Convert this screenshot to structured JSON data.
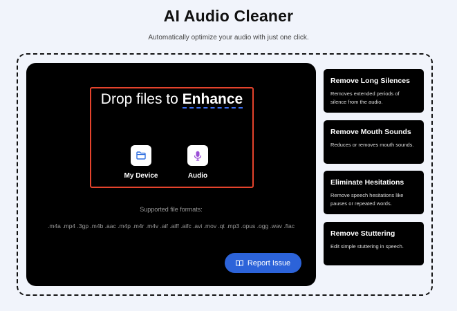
{
  "header": {
    "title": "AI Audio Cleaner",
    "subtitle": "Automatically optimize your audio with just one click."
  },
  "dropzone": {
    "title_prefix": "Drop files to ",
    "title_emphasis": "Enhance",
    "sources": [
      {
        "label": "My Device",
        "icon": "folder-icon"
      },
      {
        "label": "Audio",
        "icon": "microphone-icon"
      }
    ],
    "formats_label": "Supported file formats:",
    "formats": ".m4a .mp4 .3gp .m4b .aac .m4p .m4r .m4v .aif .aiff .aifc .avi .mov .qt .mp3 .opus .ogg .wav .flac",
    "report_label": "Report Issue",
    "report_icon": "book-icon"
  },
  "features": [
    {
      "title": "Remove Long Silences",
      "desc": "Removes extended periods of silence from the audio."
    },
    {
      "title": "Remove Mouth Sounds",
      "desc": "Reduces or removes mouth sounds."
    },
    {
      "title": "Eliminate Hesitations",
      "desc": "Remove speech hesitations like pauses or repeated words."
    },
    {
      "title": "Remove Stuttering",
      "desc": "Edit simple stuttering in speech."
    }
  ],
  "colors": {
    "background": "#f1f4fb",
    "panel": "#000000",
    "dropzone_border": "#e5432c",
    "accent_blue": "#2c63d9",
    "folder_icon": "#2f6fe0",
    "mic_icon": "#9b4fd6"
  }
}
